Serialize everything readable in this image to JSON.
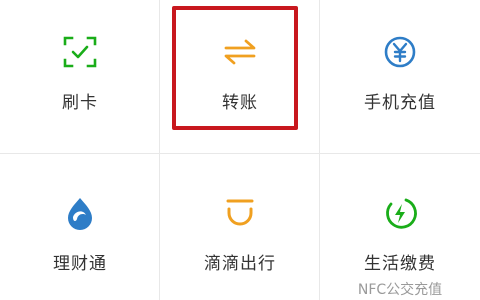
{
  "tiles": [
    {
      "label": "刷卡",
      "icon": "scan-card-icon"
    },
    {
      "label": "转账",
      "icon": "transfer-arrows-icon"
    },
    {
      "label": "手机充值",
      "icon": "yen-coin-icon"
    },
    {
      "label": "理财通",
      "icon": "wealth-drop-icon"
    },
    {
      "label": "滴滴出行",
      "icon": "didi-icon"
    },
    {
      "label": "生活缴费",
      "icon": "lightning-leaf-icon",
      "sublabel": "NFC公交充值"
    }
  ],
  "colors": {
    "green": "#1aad19",
    "orange": "#f0a020",
    "blue": "#2e7dc7",
    "highlight": "#c8181e"
  }
}
